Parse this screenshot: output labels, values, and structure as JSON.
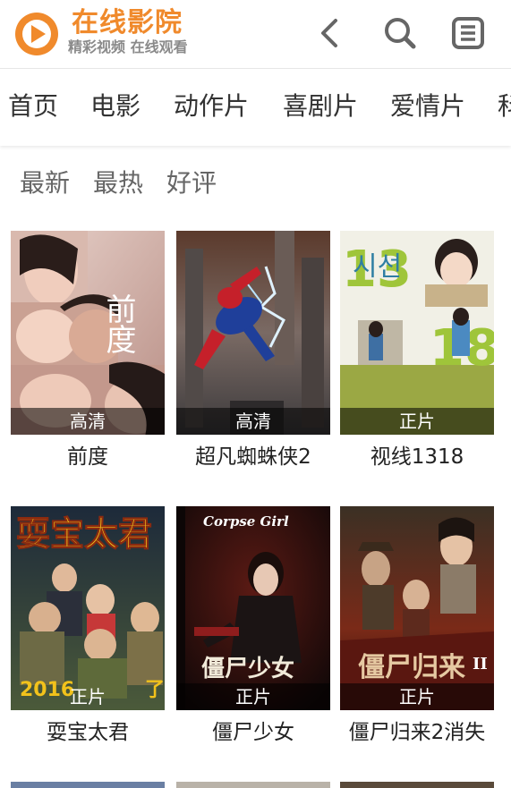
{
  "header": {
    "site_name": "在线影院",
    "tagline": "精彩视频 在线观看",
    "logo_icon": "play-circle-icon",
    "back_icon": "chevron-left-icon",
    "search_icon": "search-icon",
    "menu_icon": "list-menu-icon",
    "brand_color": "#f08a2c"
  },
  "categories": [
    "首页",
    "电影",
    "动作片",
    "喜剧片",
    "爱情片",
    "科"
  ],
  "sort_tabs": [
    "最新",
    "最热",
    "好评"
  ],
  "movies": [
    {
      "title": "前度",
      "badge": "高清"
    },
    {
      "title": "超凡蜘蛛侠2",
      "badge": "高清"
    },
    {
      "title": "视线1318",
      "badge": "正片"
    },
    {
      "title": "耍宝太君",
      "badge": "正片"
    },
    {
      "title": "僵尸少女",
      "badge": "正片"
    },
    {
      "title": "僵尸归来2消失",
      "badge": "正片"
    }
  ],
  "poster_text": {
    "p0_title": "前度",
    "p2_title": "시선",
    "p2_nums_a": "13",
    "p2_nums_b": "18",
    "p3_title": "耍宝太君",
    "p3_year": "2016",
    "p3_tail": "了",
    "p4_title_en": "Corpse Girl",
    "p4_title_cn": "僵尸少女",
    "p5_title": "僵尸归来",
    "p5_roman": "II"
  }
}
